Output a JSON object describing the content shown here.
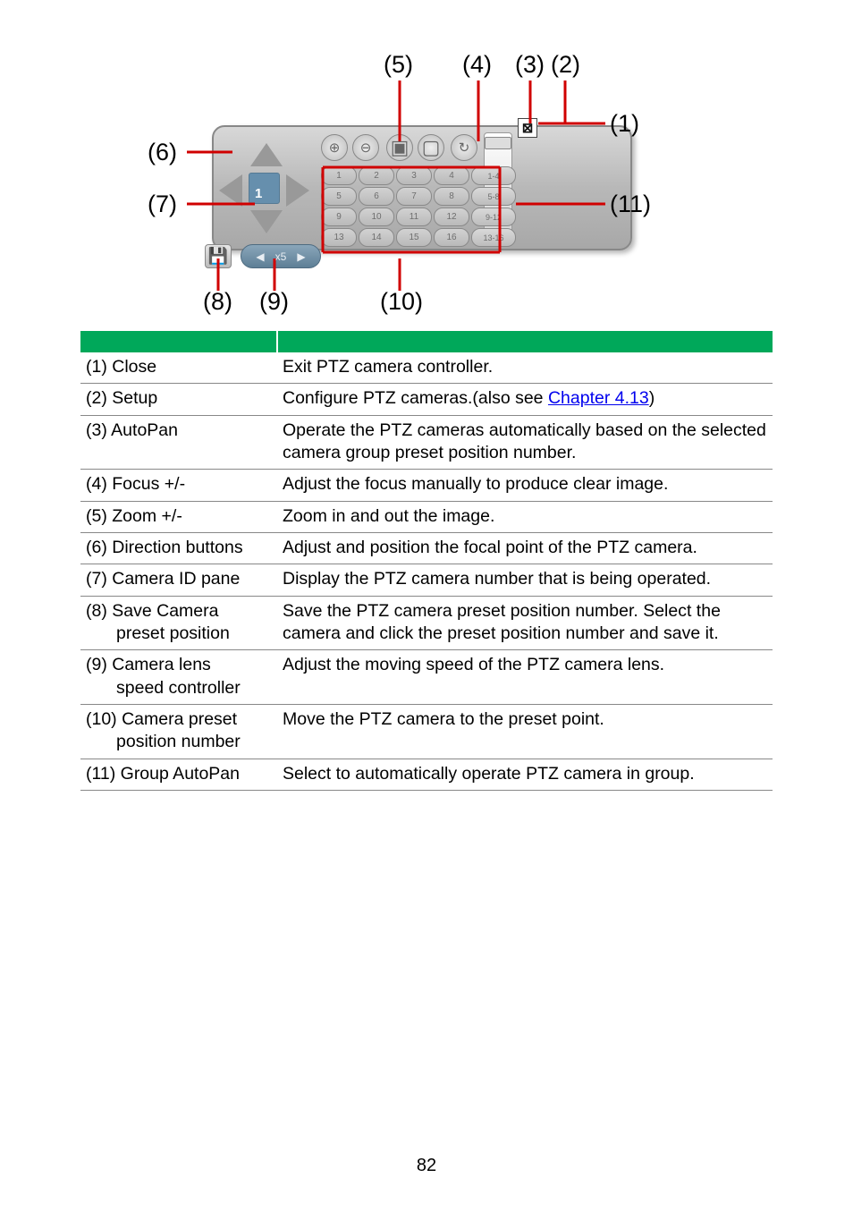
{
  "diagram": {
    "labels": {
      "l1": "(1)",
      "l2": "(2)",
      "l3": "(3)",
      "l4": "(4)",
      "l5": "(5)",
      "l6": "(6)",
      "l7": "(7)",
      "l8": "(8)",
      "l9": "(9)",
      "l10": "(10)",
      "l11": "(11)"
    },
    "camera_id": "1",
    "close_glyph": "⊠",
    "speed_left": "◀",
    "speed_text": "x5",
    "speed_right": "▶",
    "save_glyph": "💾",
    "autopan_glyph": "↻",
    "preset_buttons": [
      "1",
      "2",
      "3",
      "4",
      "1-4",
      "5",
      "6",
      "7",
      "8",
      "5-8",
      "9",
      "10",
      "11",
      "12",
      "9-12",
      "13",
      "14",
      "15",
      "16",
      "13-16"
    ]
  },
  "table": {
    "rows": [
      {
        "name": "(1) Close",
        "desc_plain": "Exit PTZ camera controller."
      },
      {
        "name": "(2) Setup",
        "desc_prefix": "Configure PTZ cameras.(also see ",
        "desc_link": "Chapter 4.13",
        "desc_suffix": ")"
      },
      {
        "name": "(3) AutoPan",
        "desc_plain": "Operate the PTZ cameras automatically based on the selected camera group preset position number."
      },
      {
        "name": "(4) Focus +/-",
        "desc_plain": "Adjust the focus manually to produce clear image."
      },
      {
        "name": "(5) Zoom +/-",
        "desc_plain": "Zoom in and out the image."
      },
      {
        "name": "(6) Direction buttons",
        "desc_plain": "Adjust and position the focal point of the PTZ camera."
      },
      {
        "name": "(7) Camera ID pane",
        "desc_plain": "Display the PTZ camera number that is being operated."
      },
      {
        "name_line1": "(8) Save Camera",
        "name_line2": "preset position",
        "desc_plain": "Save the PTZ camera preset position number. Select the camera and click the preset position number and save it."
      },
      {
        "name_line1": "(9) Camera lens",
        "name_line2": "speed controller",
        "desc_plain": "Adjust the moving speed of the PTZ camera lens."
      },
      {
        "name_line1": "(10) Camera preset",
        "name_line2": "position number",
        "desc_plain": "Move the PTZ camera to the preset point."
      },
      {
        "name": "(11) Group AutoPan",
        "desc_plain": "Select to automatically operate PTZ camera in group."
      }
    ]
  },
  "page_number": "82"
}
